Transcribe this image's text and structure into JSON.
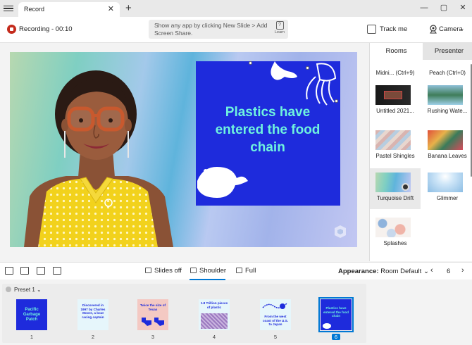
{
  "window": {
    "tab_title": "Record",
    "tab_close": "✕",
    "new_tab": "+",
    "minimize": "—",
    "maximize": "▢",
    "close": "✕"
  },
  "toolbar": {
    "recording_label": "Recording - 00:10",
    "hint_text": "Show any app by clicking New Slide > Add Screen Share.",
    "learn_label": "Learn",
    "track_me_label": "Track me",
    "camera_label": "Camera"
  },
  "slide": {
    "text": "Plastics have entered the food chain",
    "background_color": "#1e2bdc",
    "text_color": "#6ff3de"
  },
  "right_panel": {
    "tabs": [
      {
        "label": "Rooms",
        "selected": true
      },
      {
        "label": "Presenter",
        "selected": false
      }
    ],
    "rooms": [
      {
        "label": "Midni... (Ctrl+9)",
        "icon": "room-midnight"
      },
      {
        "label": "Peach (Ctrl+0)",
        "icon": "room-peach"
      },
      {
        "label": "Untitled 2021...",
        "icon": "room-untitled"
      },
      {
        "label": "Rushing Wate...",
        "icon": "room-rushing-water"
      },
      {
        "label": "Pastel Shingles",
        "icon": "room-pastel-shingles"
      },
      {
        "label": "Banana Leaves",
        "icon": "room-banana-leaves"
      },
      {
        "label": "Turquoise Drift",
        "icon": "room-turquoise-drift",
        "selected": true
      },
      {
        "label": "Glimmer",
        "icon": "room-glimmer"
      },
      {
        "label": "Splashes",
        "icon": "room-splashes"
      }
    ]
  },
  "bottom_toolbar": {
    "layouts": [
      {
        "label": "Slides off",
        "selected": false
      },
      {
        "label": "Shoulder",
        "selected": true
      },
      {
        "label": "Full",
        "selected": false
      }
    ],
    "appearance_label": "Appearance:",
    "appearance_value": "Room Default",
    "page_number": "6",
    "prev": "‹",
    "next": "›"
  },
  "slides": {
    "preset_label": "Preset 1",
    "items": [
      {
        "number": "1",
        "text": "Pacific Garbage Patch",
        "bg": "#1e2bdc",
        "fg": "#6ff3de"
      },
      {
        "number": "2",
        "text": "Discovered in 1997 by Charles Moore, a boat racing captain",
        "bg": "#e6f6fb",
        "fg": "#1e2bdc"
      },
      {
        "number": "3",
        "text": "Twice the size of Texas",
        "bg": "#f4c9c3",
        "fg": "#1e2bdc"
      },
      {
        "number": "4",
        "text": "1.8 Trillion pieces of plastic",
        "bg": "#e6f6fb",
        "fg": "#1e2bdc"
      },
      {
        "number": "5",
        "text": "From the west coast of the U.S. to Japan",
        "bg": "#e6f6fb",
        "fg": "#1e2bdc"
      },
      {
        "number": "6",
        "text": "Plastics have entered the food chain",
        "bg": "#1e2bdc",
        "fg": "#6ff3de",
        "selected": true
      }
    ]
  },
  "colors": {
    "accent": "#0078d4",
    "record_red": "#c42b1c"
  }
}
